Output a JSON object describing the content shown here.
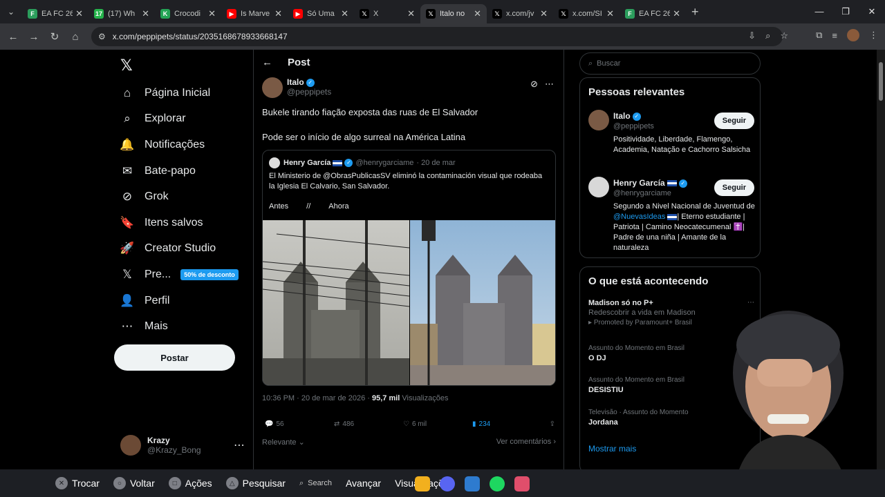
{
  "browser": {
    "tabs": [
      {
        "title": "EA FC 26",
        "color": "#2b9d5c",
        "glyph": "F"
      },
      {
        "title": "(17) Wh",
        "color": "#25b34b",
        "glyph": "17"
      },
      {
        "title": "Crocodi",
        "color": "#23a455",
        "glyph": "K"
      },
      {
        "title": "Is Marve",
        "color": "#ff0000",
        "glyph": "▶"
      },
      {
        "title": "Só Uma",
        "color": "#ff0000",
        "glyph": "▶"
      },
      {
        "title": "X",
        "color": "#000000",
        "glyph": "𝕏"
      },
      {
        "title": "Italo no",
        "color": "#000000",
        "glyph": "𝕏",
        "active": true
      },
      {
        "title": "x.com/jv",
        "color": "#000000",
        "glyph": "𝕏"
      },
      {
        "title": "x.com/SI",
        "color": "#000000",
        "glyph": "𝕏"
      },
      {
        "title": "EA FC 26",
        "color": "#2b9d5c",
        "glyph": "F"
      }
    ],
    "url": "x.com/peppipets/status/2035168678933668147"
  },
  "nav": {
    "items": [
      {
        "label": "Página Inicial",
        "icon": "⌂"
      },
      {
        "label": "Explorar",
        "icon": "⌕"
      },
      {
        "label": "Notificações",
        "icon": "🔔"
      },
      {
        "label": "Bate-papo",
        "icon": "✉"
      },
      {
        "label": "Grok",
        "icon": "⊘"
      },
      {
        "label": "Itens salvos",
        "icon": "🔖"
      },
      {
        "label": "Creator Studio",
        "icon": "🚀"
      },
      {
        "label": "Pre...",
        "icon": "𝕏"
      },
      {
        "label": "Perfil",
        "icon": "👤"
      },
      {
        "label": "Mais",
        "icon": "⋯"
      }
    ],
    "premium_badge": "50% de desconto",
    "post_button": "Postar",
    "me": {
      "name": "Krazy",
      "handle": "@Krazy_Bong"
    }
  },
  "post": {
    "header": "Post",
    "author": "Italo",
    "handle": "@peppipets",
    "line1": "Bukele tirando fiação exposta das ruas de El Salvador",
    "line2": "Pode ser o início de algo surreal na América Latina",
    "quote": {
      "name": "Henry García",
      "handle": "@henrygarciame",
      "date": "· 20 de mar",
      "text": "El Ministerio de @ObrasPublicasSV eliminó la contaminación visual que rodeaba la Iglesia El Calvario, San Salvador.",
      "antes": "Antes",
      "sep": "//",
      "ahora": "Ahora"
    },
    "time": "10:36 PM · 20 de mar de 2026 · ",
    "views_count": "95,7 mil",
    "views_label": " Visualizações",
    "replies": "56",
    "reposts": "486",
    "likes": "6 mil",
    "bookmarks": "234",
    "sort": "Relevante",
    "see_replies": "Ver comentários"
  },
  "right": {
    "search_placeholder": "Buscar",
    "relevant_title": "Pessoas relevantes",
    "people": [
      {
        "name": "Italo",
        "handle": "@peppipets",
        "bio": "Positividade, Liberdade, Flamengo, Academia, Natação e Cachorro Salsicha",
        "follow": "Seguir"
      },
      {
        "name": "Henry García",
        "handle": "@henrygarciame",
        "bio_pre": "Segundo a Nivel Nacional de Juventud de ",
        "bio_link": "@NuevasIdeas",
        "bio_post": "| Eterno estudiante | Patriota | Camino Neocatecumenal ✝️| Padre de una niña | Amante de la naturaleza",
        "follow": "Seguir"
      }
    ],
    "trending_title": "O que está acontecendo",
    "trends": [
      {
        "title": "Madison só no P+",
        "sub": "Redescobrir a vida em Madison",
        "promo": "Promoted by Paramount+ Brasil"
      },
      {
        "context": "Assunto do Momento em Brasil",
        "title": "O DJ"
      },
      {
        "context": "Assunto do Momento em Brasil",
        "title": "DESISTIU"
      },
      {
        "context": "Televisão · Assunto do Momento",
        "title": "Jordana"
      }
    ],
    "show_more": "Mostrar mais"
  },
  "taskbar": {
    "trocar": "Trocar",
    "voltar": "Voltar",
    "acoes": "Ações",
    "pesquisar": "Pesquisar",
    "search": "Search",
    "avancar": "Avançar",
    "visualizacoes": "Visualizações"
  }
}
